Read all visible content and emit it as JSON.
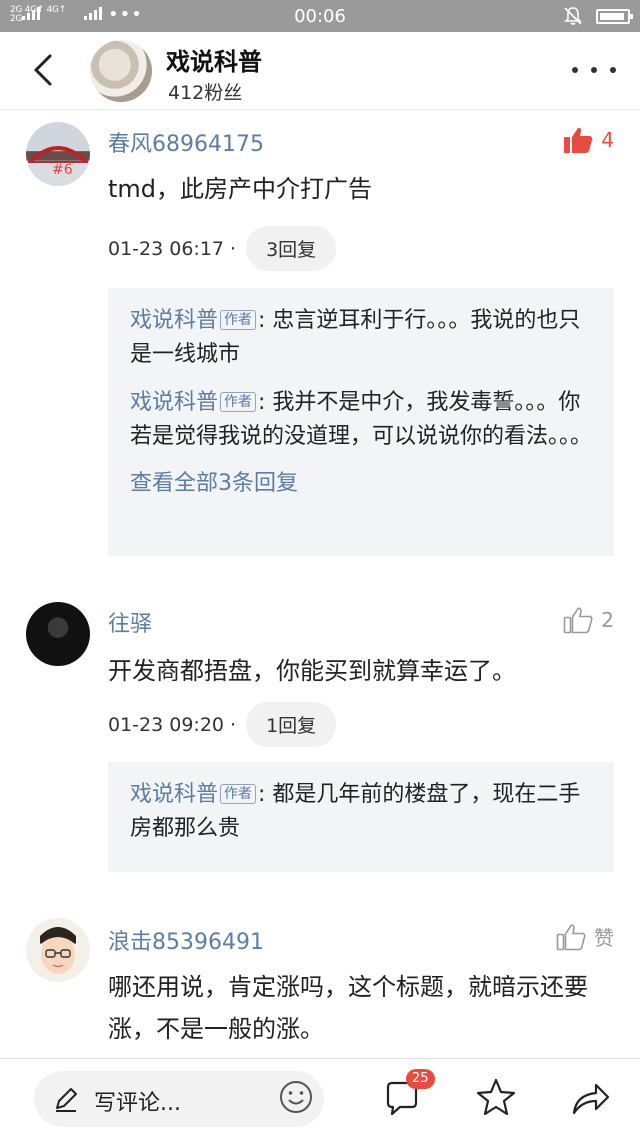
{
  "status_bar": {
    "network_top": "2G 4G↑ 4G↑",
    "network_bottom": "2G",
    "more": "•••",
    "time": "00:06"
  },
  "header": {
    "title": "戏说科普",
    "fans": "412粉丝"
  },
  "comments": [
    {
      "user": "春风68964175",
      "avatar_label": "#6",
      "likes": "4",
      "liked": true,
      "text": "tmd，此房产中介打广告",
      "time": "01-23 06:17 ·",
      "reply_count": "3回复",
      "replies": [
        {
          "name": "戏说科普",
          "tag": "作者",
          "text": ": 忠言逆耳利于行。。。我说的也只是一线城市"
        },
        {
          "name": "戏说科普",
          "tag": "作者",
          "text": ": 我并不是中介，我发毒誓。。。你若是觉得我说的没道理，可以说说你的看法。。。"
        }
      ],
      "view_all": "查看全部3条回复"
    },
    {
      "user": "往驿",
      "likes": "2",
      "liked": false,
      "text": "开发商都捂盘，你能买到就算幸运了。",
      "time": "01-23 09:20 ·",
      "reply_count": "1回复",
      "replies": [
        {
          "name": "戏说科普",
          "tag": "作者",
          "text": ": 都是几年前的楼盘了，现在二手房都那么贵"
        }
      ]
    },
    {
      "user": "浪击85396491",
      "likes": "赞",
      "liked": false,
      "text": "哪还用说，肯定涨吗，这个标题，就暗示还要涨，不是一般的涨。"
    }
  ],
  "bottom_bar": {
    "write_placeholder": "写评论...",
    "comment_count": "25"
  },
  "colors": {
    "accent_blue": "#5b7da6",
    "like_red": "#e84b40",
    "status_bar": "#9a9a9a"
  },
  "icons": [
    "back-arrow-icon",
    "more-dots-icon",
    "thumbs-up-icon",
    "pen-icon",
    "emoji-icon",
    "comment-icon",
    "star-icon",
    "share-icon"
  ]
}
